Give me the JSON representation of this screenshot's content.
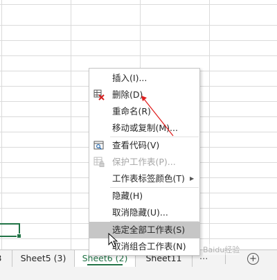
{
  "sheet_tabs": [
    {
      "label": "3",
      "active": false
    },
    {
      "label": "Sheet5 (3)",
      "active": false
    },
    {
      "label": "Sheet6 (2)",
      "active": true
    },
    {
      "label": "Sheet11",
      "active": false
    }
  ],
  "tabbar": {
    "overflow": "...",
    "add": "+"
  },
  "context_menu": {
    "items": [
      {
        "label": "插入(I)...",
        "icon": "",
        "enabled": true
      },
      {
        "label": "删除(D)",
        "icon": "delete-sheet-icon",
        "enabled": true
      },
      {
        "label": "重命名(R)",
        "icon": "",
        "enabled": true
      },
      {
        "label": "移动或复制(M)...",
        "icon": "",
        "enabled": true
      },
      {
        "label": "查看代码(V)",
        "icon": "view-code-icon",
        "enabled": true
      },
      {
        "label": "保护工作表(P)...",
        "icon": "protect-sheet-icon",
        "enabled": false
      },
      {
        "label": "工作表标签颜色(T)",
        "icon": "",
        "enabled": true,
        "submenu": true
      },
      {
        "label": "隐藏(H)",
        "icon": "",
        "enabled": true
      },
      {
        "label": "取消隐藏(U)...",
        "icon": "",
        "enabled": true
      },
      {
        "label": "选定全部工作表(S)",
        "icon": "",
        "enabled": true,
        "highlighted": true
      },
      {
        "label": "取消组合工作表(N)",
        "icon": "",
        "enabled": true
      }
    ]
  },
  "colors": {
    "accent_green": "#217346",
    "arrow_red": "#e02020",
    "highlight": "#c6c6c6"
  },
  "watermark": "Baidu经验"
}
